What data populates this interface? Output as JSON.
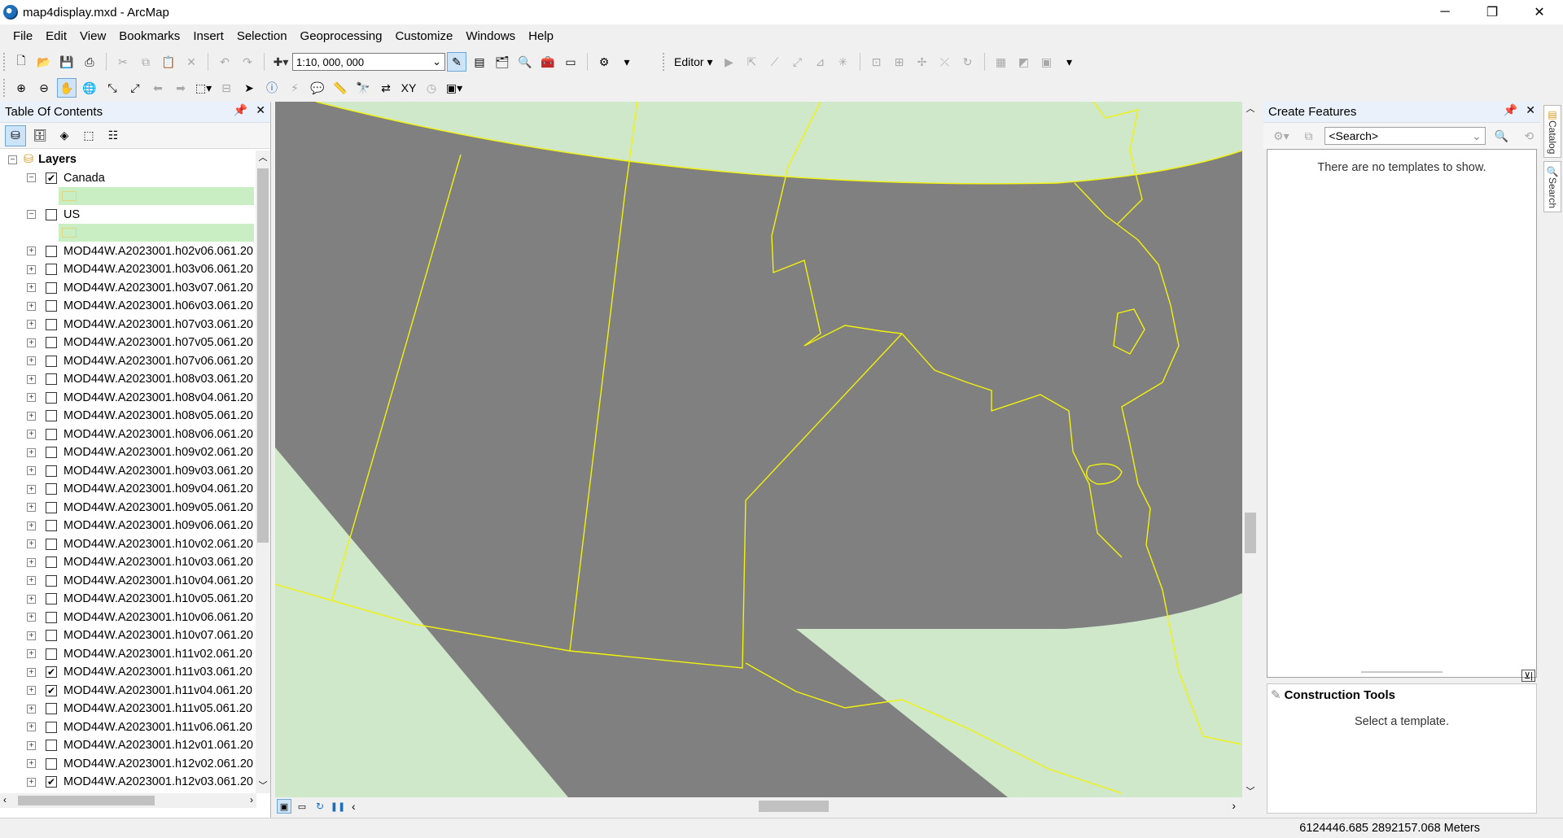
{
  "window": {
    "title": "map4display.mxd - ArcMap",
    "min": "─",
    "max": "❐",
    "close": "✕"
  },
  "menu": [
    "File",
    "Edit",
    "View",
    "Bookmarks",
    "Insert",
    "Selection",
    "Geoprocessing",
    "Customize",
    "Windows",
    "Help"
  ],
  "toolbar": {
    "scale": "1:10, 000, 000",
    "editor": "Editor ▾"
  },
  "toc": {
    "title": "Table Of Contents",
    "group": "Layers",
    "canada": "Canada",
    "us": "US",
    "layers": [
      {
        "name": "MOD44W.A2023001.h02v06.061.20",
        "checked": false
      },
      {
        "name": "MOD44W.A2023001.h03v06.061.20",
        "checked": false
      },
      {
        "name": "MOD44W.A2023001.h03v07.061.20",
        "checked": false
      },
      {
        "name": "MOD44W.A2023001.h06v03.061.20",
        "checked": false
      },
      {
        "name": "MOD44W.A2023001.h07v03.061.20",
        "checked": false
      },
      {
        "name": "MOD44W.A2023001.h07v05.061.20",
        "checked": false
      },
      {
        "name": "MOD44W.A2023001.h07v06.061.20",
        "checked": false
      },
      {
        "name": "MOD44W.A2023001.h08v03.061.20",
        "checked": false
      },
      {
        "name": "MOD44W.A2023001.h08v04.061.20",
        "checked": false
      },
      {
        "name": "MOD44W.A2023001.h08v05.061.20",
        "checked": false
      },
      {
        "name": "MOD44W.A2023001.h08v06.061.20",
        "checked": false
      },
      {
        "name": "MOD44W.A2023001.h09v02.061.20",
        "checked": false
      },
      {
        "name": "MOD44W.A2023001.h09v03.061.20",
        "checked": false
      },
      {
        "name": "MOD44W.A2023001.h09v04.061.20",
        "checked": false
      },
      {
        "name": "MOD44W.A2023001.h09v05.061.20",
        "checked": false
      },
      {
        "name": "MOD44W.A2023001.h09v06.061.20",
        "checked": false
      },
      {
        "name": "MOD44W.A2023001.h10v02.061.20",
        "checked": false
      },
      {
        "name": "MOD44W.A2023001.h10v03.061.20",
        "checked": false
      },
      {
        "name": "MOD44W.A2023001.h10v04.061.20",
        "checked": false
      },
      {
        "name": "MOD44W.A2023001.h10v05.061.20",
        "checked": false
      },
      {
        "name": "MOD44W.A2023001.h10v06.061.20",
        "checked": false
      },
      {
        "name": "MOD44W.A2023001.h10v07.061.20",
        "checked": false
      },
      {
        "name": "MOD44W.A2023001.h11v02.061.20",
        "checked": false
      },
      {
        "name": "MOD44W.A2023001.h11v03.061.20",
        "checked": true
      },
      {
        "name": "MOD44W.A2023001.h11v04.061.20",
        "checked": true
      },
      {
        "name": "MOD44W.A2023001.h11v05.061.20",
        "checked": false
      },
      {
        "name": "MOD44W.A2023001.h11v06.061.20",
        "checked": false
      },
      {
        "name": "MOD44W.A2023001.h12v01.061.20",
        "checked": false
      },
      {
        "name": "MOD44W.A2023001.h12v02.061.20",
        "checked": false
      },
      {
        "name": "MOD44W.A2023001.h12v03.061.20",
        "checked": true
      }
    ]
  },
  "create_features": {
    "title": "Create Features",
    "search_placeholder": "<Search>",
    "empty_msg": "There are no templates to show.",
    "construction_title": "Construction Tools",
    "construction_msg": "Select a template."
  },
  "side_tabs": [
    "Catalog",
    "Search"
  ],
  "status": {
    "coords": "6124446.685  2892157.068 Meters"
  },
  "colors": {
    "map_background": "#cfe8c9",
    "raster": "#808080",
    "boundary": "#f2f20a",
    "panel_header": "#eaf1fa"
  }
}
